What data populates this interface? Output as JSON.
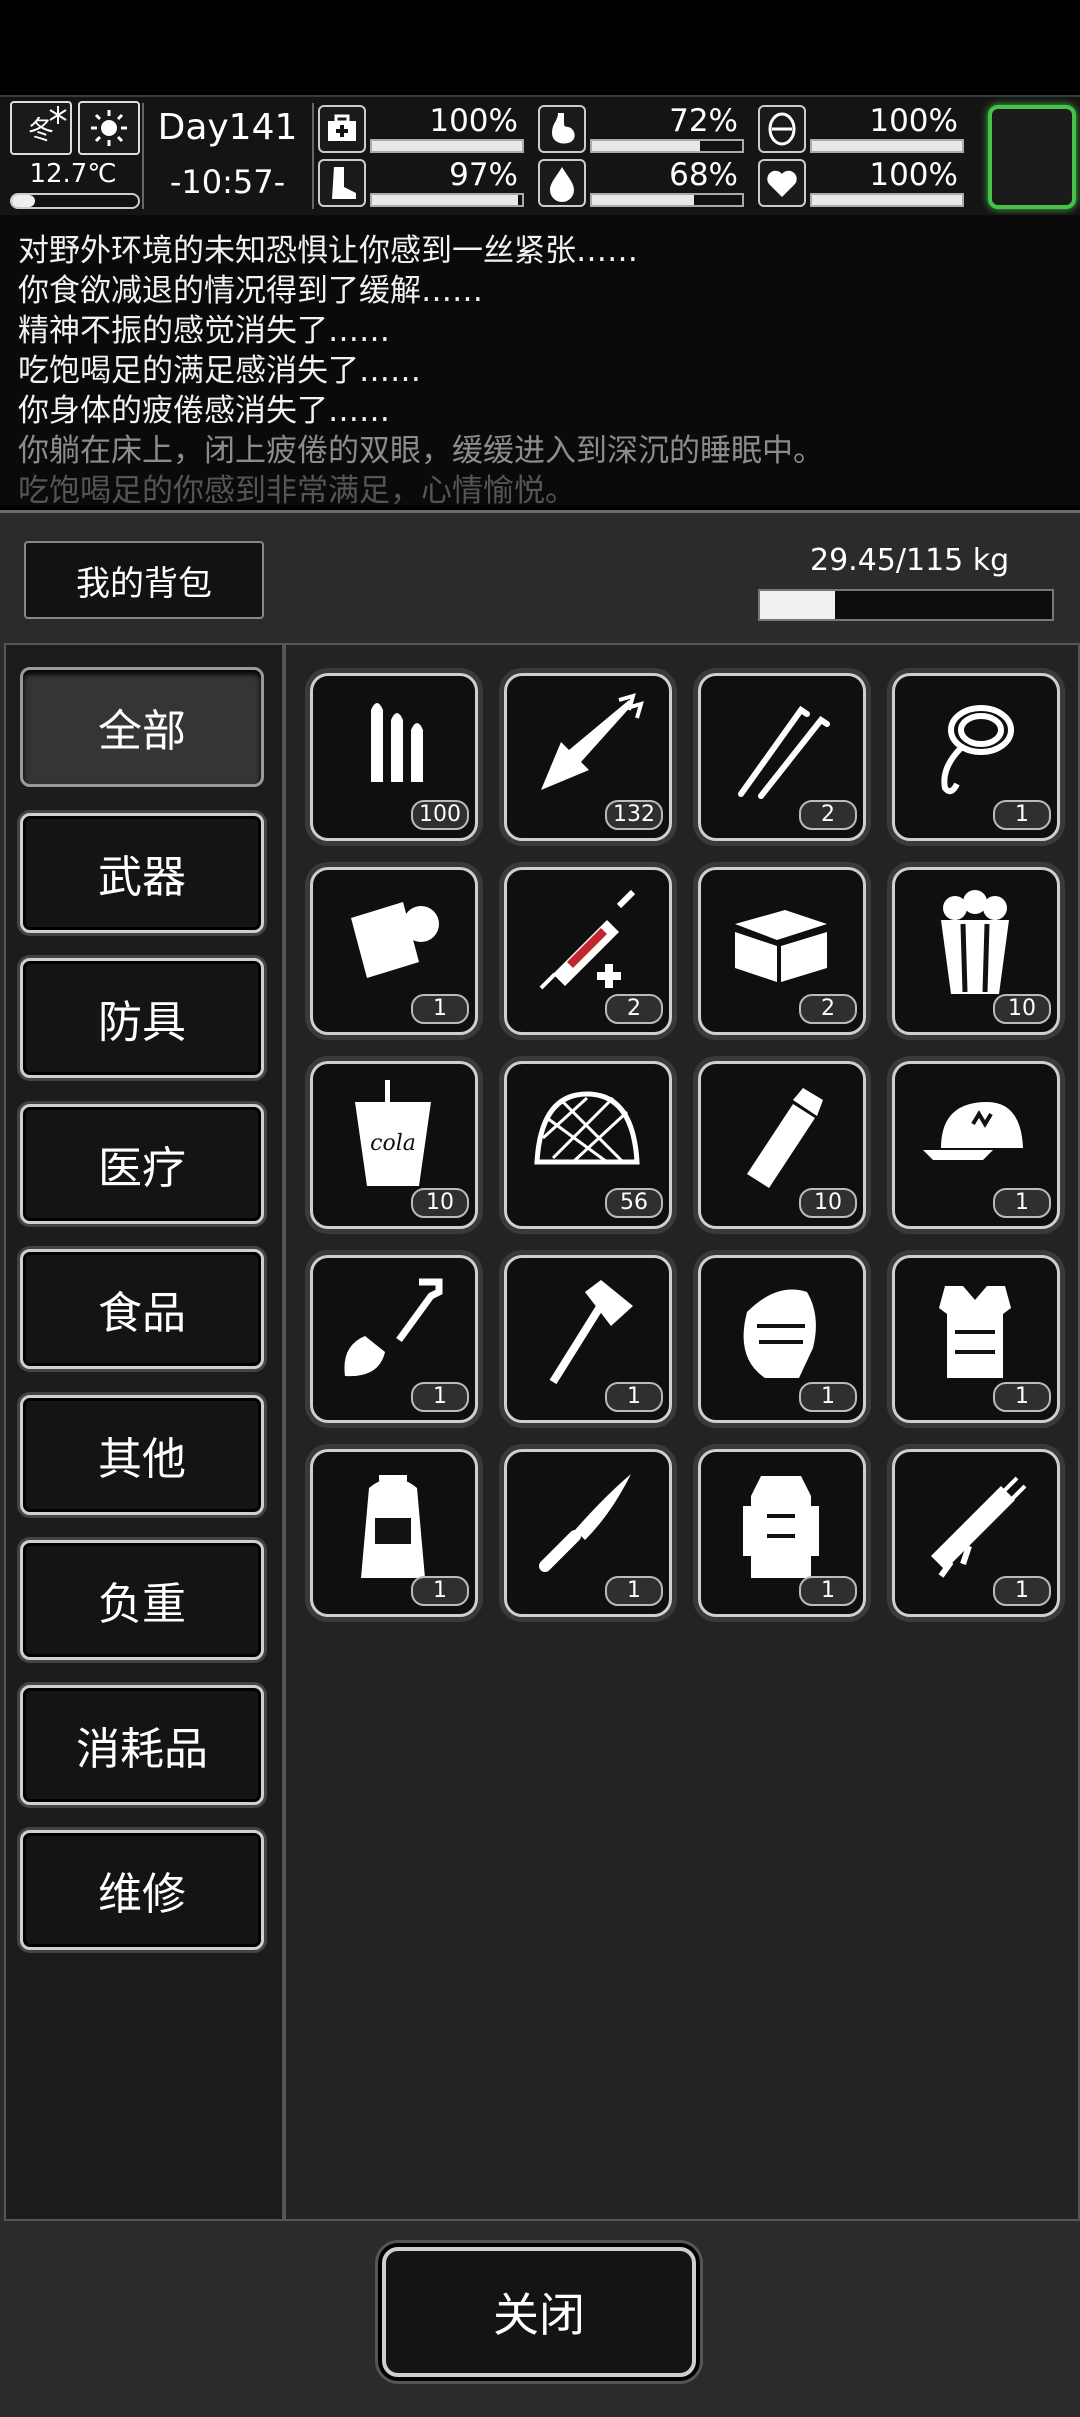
{
  "status": {
    "season": "冬",
    "season_icon": "snowflake-icon",
    "weather_icon": "sun-icon",
    "temperature": "12.7℃",
    "temperature_level": 0.18,
    "day": "Day141",
    "time": "-10:57-",
    "stats": [
      {
        "name": "health",
        "icon": "medkit-icon",
        "label": "100%",
        "value": 100
      },
      {
        "name": "hunger",
        "icon": "stomach-icon",
        "label": "72%",
        "value": 72
      },
      {
        "name": "mental",
        "icon": "brain-icon",
        "label": "100%",
        "value": 100
      },
      {
        "name": "stamina",
        "icon": "foot-icon",
        "label": "97%",
        "value": 97
      },
      {
        "name": "thirst",
        "icon": "water-drop-icon",
        "label": "68%",
        "value": 68
      },
      {
        "name": "mood",
        "icon": "heart-icon",
        "label": "100%",
        "value": 100
      }
    ],
    "accent_color": "#49c24a"
  },
  "log": {
    "lines": [
      "对野外环境的未知恐惧让你感到一丝紧张……",
      "你食欲减退的情况得到了缓解……",
      "精神不振的感觉消失了……",
      "吃饱喝足的满足感消失了……",
      "你身体的疲倦感消失了……",
      "你躺在床上，闭上疲倦的双眼，缓缓进入到深沉的睡眠中。",
      "吃饱喝足的你感到非常满足，心情愉悦。"
    ]
  },
  "backpack": {
    "title": "我的背包",
    "weight_text": "29.45/115 kg",
    "weight_fraction": 0.256,
    "categories": [
      "全部",
      "武器",
      "防具",
      "医疗",
      "食品",
      "其他",
      "负重",
      "消耗品",
      "维修"
    ],
    "active_category": "全部",
    "items": [
      {
        "icon": "bullets-icon",
        "count": "100"
      },
      {
        "icon": "arrow-icon",
        "count": "132"
      },
      {
        "icon": "lockpick-icon",
        "count": "2"
      },
      {
        "icon": "rope-icon",
        "count": "1"
      },
      {
        "icon": "bandage-roll-icon",
        "count": "1"
      },
      {
        "icon": "syringe-icon",
        "count": "2"
      },
      {
        "icon": "toolbox-icon",
        "count": "2"
      },
      {
        "icon": "popcorn-icon",
        "count": "10"
      },
      {
        "icon": "cola-cup-icon",
        "count": "10",
        "text": "cola"
      },
      {
        "icon": "net-helmet-icon",
        "count": "56"
      },
      {
        "icon": "flashlight-icon",
        "count": "10"
      },
      {
        "icon": "cap-icon",
        "count": "1"
      },
      {
        "icon": "shovel-icon",
        "count": "1"
      },
      {
        "icon": "axe-icon",
        "count": "1"
      },
      {
        "icon": "gloves-icon",
        "count": "1"
      },
      {
        "icon": "vest-icon",
        "count": "1"
      },
      {
        "icon": "backpack-icon",
        "count": "1"
      },
      {
        "icon": "knife-icon",
        "count": "1"
      },
      {
        "icon": "hiking-backpack-icon",
        "count": "1"
      },
      {
        "icon": "minigun-icon",
        "count": "1"
      }
    ],
    "close_label": "关闭"
  }
}
